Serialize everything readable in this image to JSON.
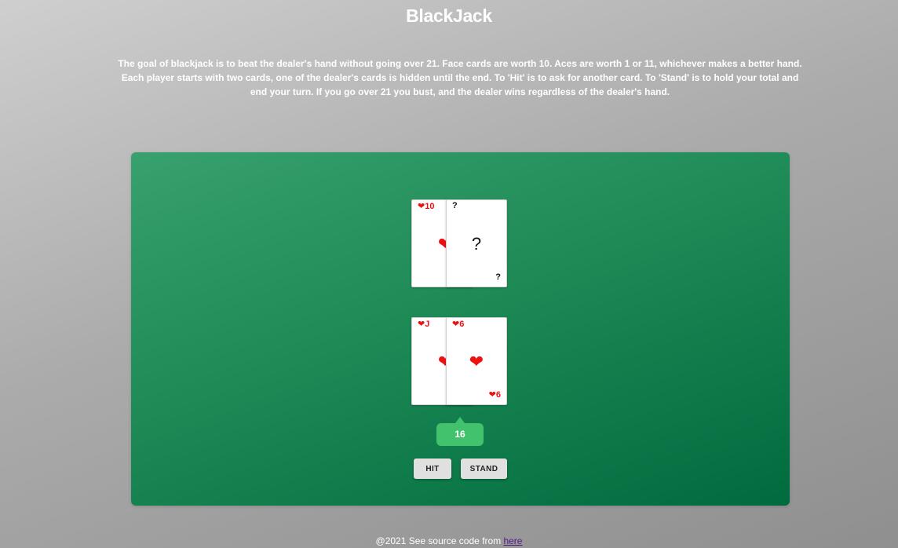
{
  "title": "BlackJack",
  "rules": "The goal of blackjack is to beat the dealer's hand without going over 21. Face cards are worth 10. Aces are worth 1 or 11, whichever makes a better hand. Each player starts with two cards, one of the dealer's cards is hidden until the end. To 'Hit' is to ask for another card. To 'Stand' is to hold your total and end your turn. If you go over 21 you bust, and the dealer wins regardless of the dealer's hand.",
  "dealer": {
    "cards": [
      {
        "corner": "❤10",
        "center": "❤",
        "suit_color": "#ee1111"
      },
      {
        "corner": "?",
        "center": "?",
        "corner_bottom": "?",
        "hidden": true
      }
    ]
  },
  "player": {
    "cards": [
      {
        "corner": "❤J",
        "center": "❤",
        "suit_color": "#ee1111"
      },
      {
        "corner": "❤6",
        "center": "❤",
        "corner_bottom": "❤6",
        "suit_color": "#ee1111"
      }
    ],
    "score": "16"
  },
  "buttons": {
    "hit": "HIT",
    "stand": "STAND"
  },
  "footer": {
    "text": "@2021 See source code from ",
    "link": "here"
  },
  "colors": {
    "table_green": "#1e8a56",
    "score_green": "#43c26e",
    "heart_red": "#ee1111"
  }
}
